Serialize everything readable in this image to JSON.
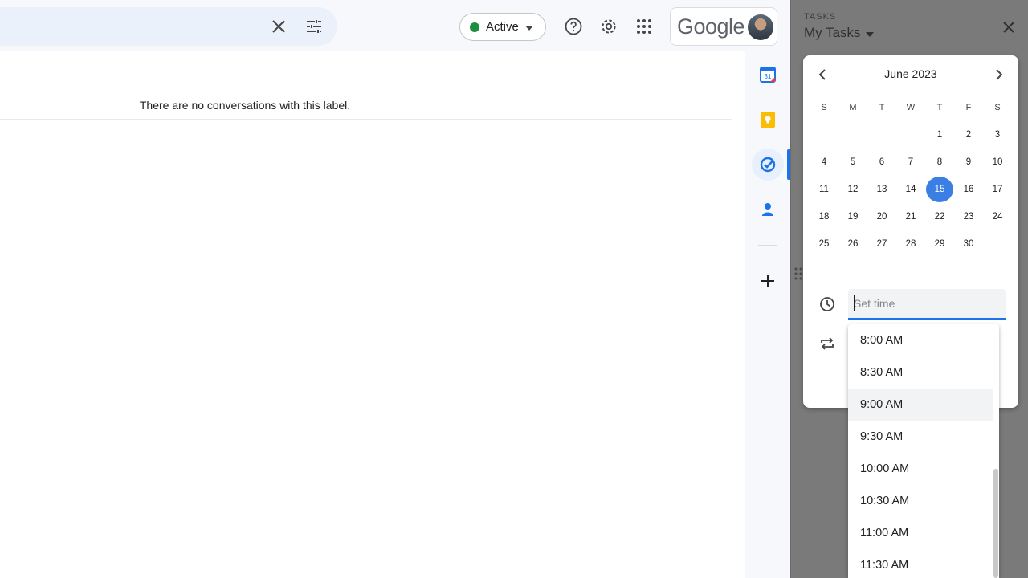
{
  "search": {
    "clear_icon": "close-icon",
    "options_icon": "tune-icon"
  },
  "status": {
    "label": "Active",
    "color": "#1e8e3e"
  },
  "header": {
    "brand": "Google",
    "icons": [
      "help-icon",
      "gear-icon",
      "apps-grid-icon"
    ]
  },
  "main": {
    "empty_message": "There are no conversations with this label."
  },
  "rail": {
    "items": [
      "calendar-icon",
      "keep-icon",
      "tasks-icon",
      "contacts-icon"
    ],
    "calendar_number": "31",
    "add_icon": "plus-icon"
  },
  "tasks": {
    "kicker": "TASKS",
    "title": "My Tasks"
  },
  "calendar": {
    "month": "June 2023",
    "weekdays": [
      "S",
      "M",
      "T",
      "W",
      "T",
      "F",
      "S"
    ],
    "leading_blanks": 4,
    "days": [
      "1",
      "2",
      "3",
      "4",
      "5",
      "6",
      "7",
      "8",
      "9",
      "10",
      "11",
      "12",
      "13",
      "14",
      "15",
      "16",
      "17",
      "18",
      "19",
      "20",
      "21",
      "22",
      "23",
      "24",
      "25",
      "26",
      "27",
      "28",
      "29",
      "30"
    ],
    "selected_day": "15",
    "accent": "#3b7fe4"
  },
  "time": {
    "placeholder": "Set time",
    "options": [
      "8:00 AM",
      "8:30 AM",
      "9:00 AM",
      "9:30 AM",
      "10:00 AM",
      "10:30 AM",
      "11:00 AM",
      "11:30 AM"
    ],
    "hovered": "9:00 AM"
  }
}
